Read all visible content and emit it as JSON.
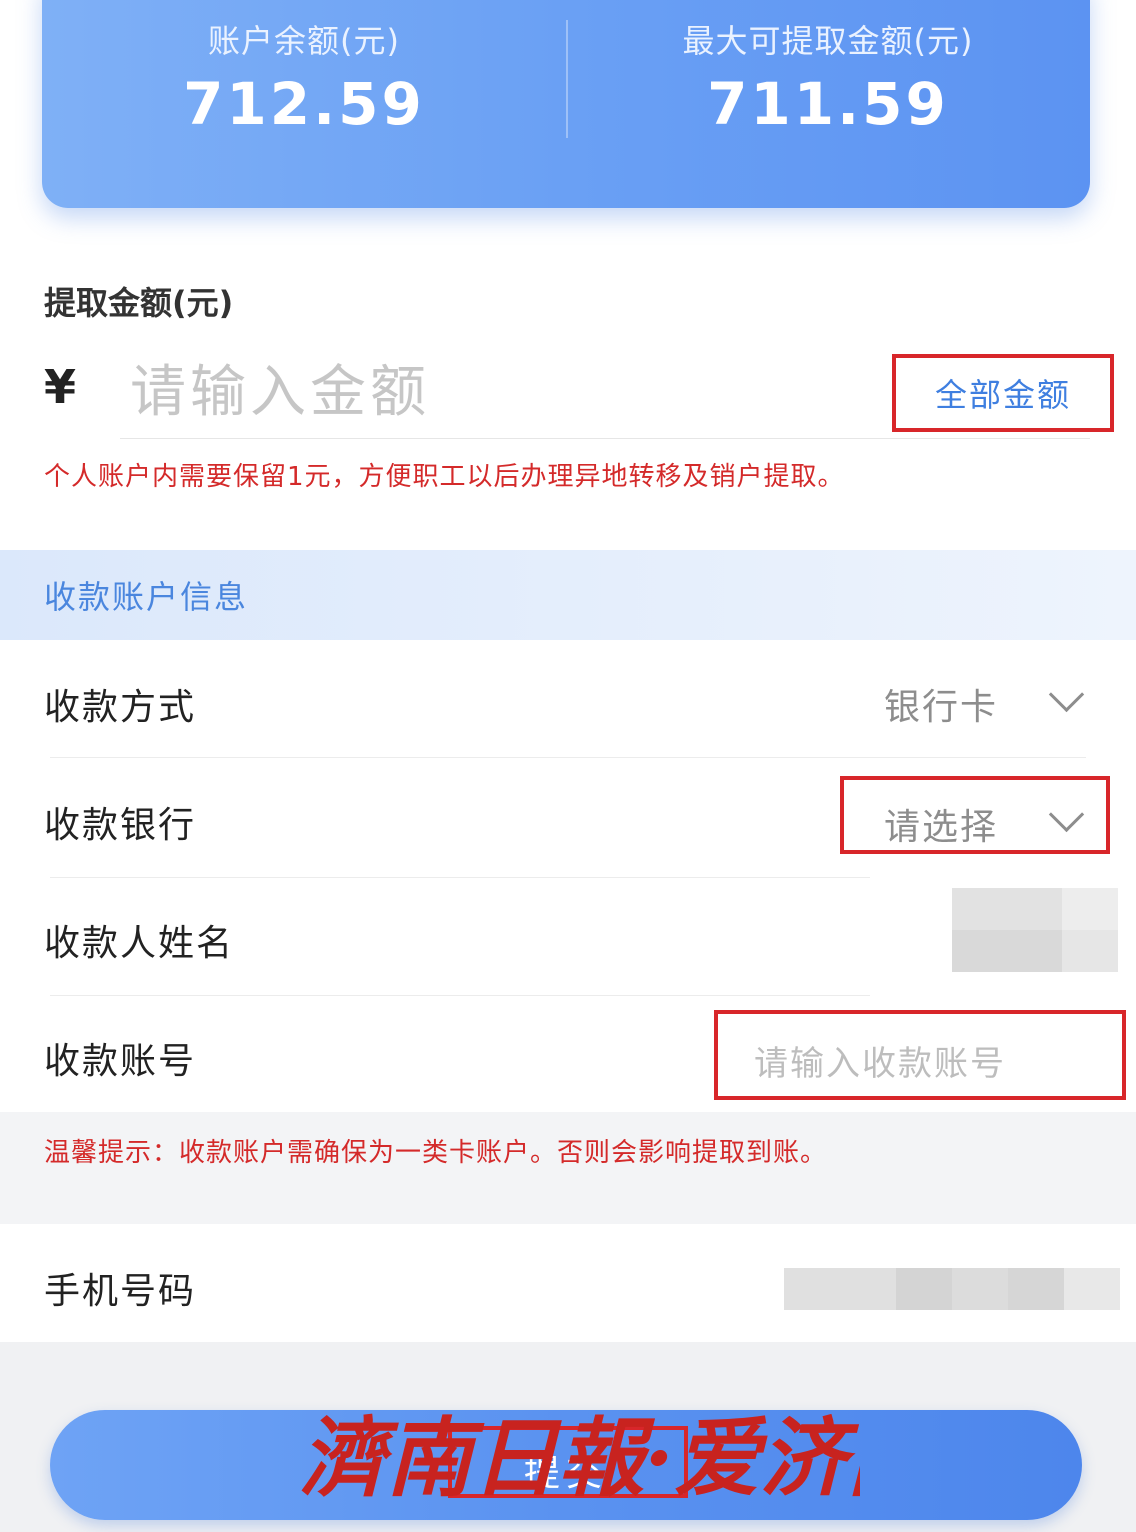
{
  "balance_card": {
    "balance_label": "账户余额(元)",
    "balance_value": "712.59",
    "max_label": "最大可提取金额(元)",
    "max_value": "711.59"
  },
  "withdraw": {
    "section_label": "提取金额(元)",
    "currency_symbol": "¥",
    "amount_placeholder": "请输入金额",
    "all_amount_button": "全部金额",
    "note": "个人账户内需要保留1元，方便职工以后办理异地转移及销户提取。"
  },
  "account_info": {
    "section_title": "收款账户信息",
    "method_label": "收款方式",
    "method_value": "银行卡",
    "bank_label": "收款银行",
    "bank_value": "请选择",
    "payee_label": "收款人姓名",
    "account_label": "收款账号",
    "account_placeholder": "请输入收款账号",
    "tip": "温馨提示：收款账户需确保为一类卡账户。否则会影响提取到账。",
    "phone_label": "手机号码"
  },
  "submit": {
    "label": "提交"
  },
  "watermark": {
    "text": "濟南日報·爱济南"
  },
  "colors": {
    "accent_blue": "#5c93f2",
    "warning_red": "#d42a2a",
    "highlight_box": "#d8262a"
  }
}
